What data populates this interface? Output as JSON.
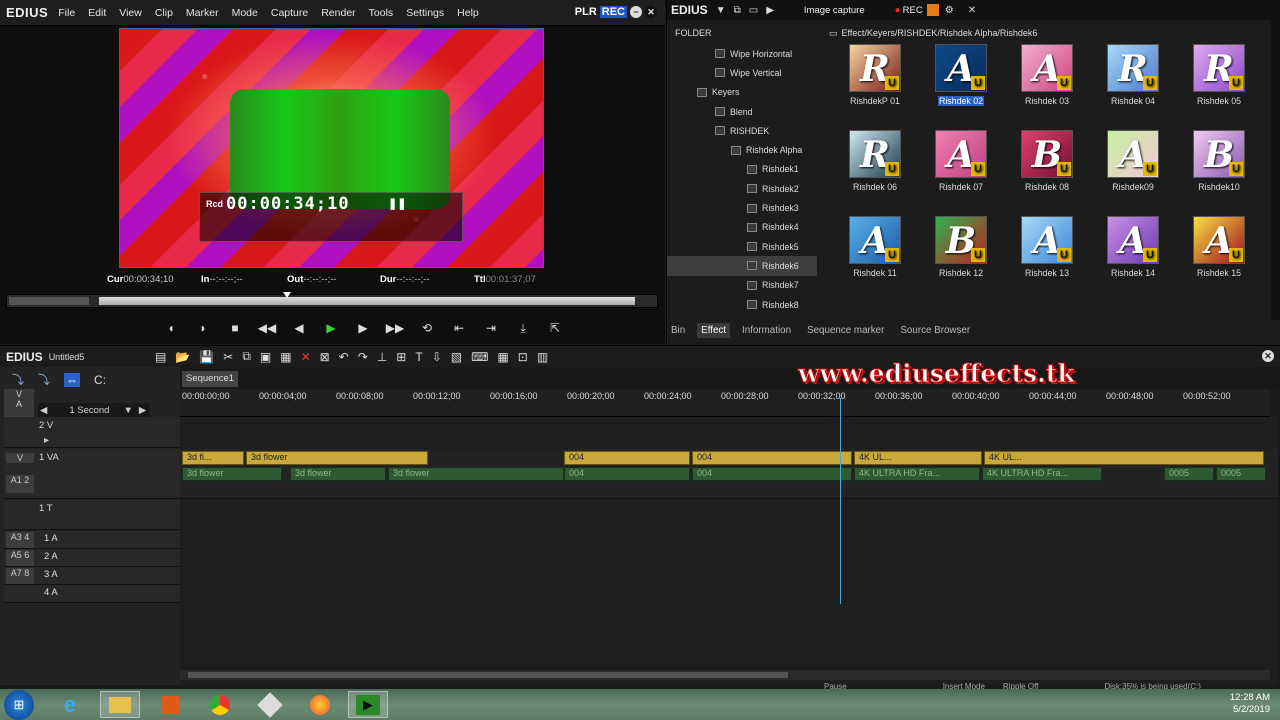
{
  "app": {
    "name": "EDIUS",
    "menu": [
      "File",
      "Edit",
      "View",
      "Clip",
      "Marker",
      "Mode",
      "Capture",
      "Render",
      "Tools",
      "Settings",
      "Help"
    ],
    "plr": "PLR",
    "rec": "REC"
  },
  "player": {
    "rcd": "Rcd",
    "timecode": "00:00:34;10",
    "cur_label": "Cur",
    "cur": "00:00:34;10",
    "in_label": "In",
    "in": "--:--:--;--",
    "out_label": "Out",
    "out": "--:--:--;--",
    "dur_label": "Dur",
    "dur": "--:--:--;--",
    "ttl_label": "Ttl",
    "ttl": "00:01:37;07",
    "playhead_fraction": 0.35
  },
  "right": {
    "logo": "EDIUS",
    "capture": "Image capture",
    "rec": "REC",
    "folder": "FOLDER",
    "path": "Effect/Keyers/RISHDEK/Rishdek Alpha/Rishdek6",
    "tree": [
      {
        "label": "Wipe Horizontal",
        "indent": 48
      },
      {
        "label": "Wipe Vertical",
        "indent": 48
      },
      {
        "label": "Keyers",
        "indent": 30
      },
      {
        "label": "Blend",
        "indent": 48
      },
      {
        "label": "RISHDEK",
        "indent": 48
      },
      {
        "label": "Rishdek Alpha",
        "indent": 64
      },
      {
        "label": "Rishdek1",
        "indent": 80
      },
      {
        "label": "Rishdek2",
        "indent": 80
      },
      {
        "label": "Rishdek3",
        "indent": 80
      },
      {
        "label": "Rishdek4",
        "indent": 80
      },
      {
        "label": "Rishdek5",
        "indent": 80
      },
      {
        "label": "Rishdek6",
        "indent": 80
      },
      {
        "label": "Rishdek7",
        "indent": 80
      },
      {
        "label": "Rishdek8",
        "indent": 80
      }
    ],
    "effects": [
      {
        "name": "RishdekP 01",
        "letter": "R",
        "c1": "#f5d7a0",
        "c2": "#7a1a1a"
      },
      {
        "name": "Rishdek 02",
        "letter": "A",
        "c1": "#0c4a8a",
        "c2": "#0a2a5a"
      },
      {
        "name": "Rishdek 03",
        "letter": "A",
        "c1": "#f0b0d0",
        "c2": "#d04080"
      },
      {
        "name": "Rishdek 04",
        "letter": "R",
        "c1": "#a8d8f8",
        "c2": "#4a7ac8"
      },
      {
        "name": "Rishdek 05",
        "letter": "R",
        "c1": "#e0a8f0",
        "c2": "#8a4ac8"
      },
      {
        "name": "Rishdek 06",
        "letter": "R",
        "c1": "#d0e8f0",
        "c2": "#1a3a4a"
      },
      {
        "name": "Rishdek 07",
        "letter": "A",
        "c1": "#f080b0",
        "c2": "#c04080"
      },
      {
        "name": "Rishdek 08",
        "letter": "B",
        "c1": "#e04070",
        "c2": "#701030"
      },
      {
        "name": "Rishdek09",
        "letter": "A",
        "c1": "#c8f0a0",
        "c2": "#f0c8d8"
      },
      {
        "name": "Rishdek10",
        "letter": "B",
        "c1": "#f0c8f0",
        "c2": "#8a5ab0"
      },
      {
        "name": "Rishdek 11",
        "letter": "A",
        "c1": "#5ab0e8",
        "c2": "#1a5aa8"
      },
      {
        "name": "Rishdek 12",
        "letter": "B",
        "c1": "#30b050",
        "c2": "#c02020"
      },
      {
        "name": "Rishdek 13",
        "letter": "A",
        "c1": "#a8d8f8",
        "c2": "#3a88d8"
      },
      {
        "name": "Rishdek 14",
        "letter": "A",
        "c1": "#c890e8",
        "c2": "#6a3ab0"
      },
      {
        "name": "Rishdek 15",
        "letter": "A",
        "c1": "#f8e040",
        "c2": "#a01020"
      }
    ],
    "tabs": [
      "Bin",
      "Effect",
      "Information",
      "Sequence marker",
      "Source Browser"
    ]
  },
  "timeline": {
    "logo": "EDIUS",
    "project": "Untitled5",
    "sequence": "Sequence1",
    "zoom": "1 Second",
    "watermark": "www.ediuseffects.tk",
    "ruler": [
      "00:00:00;00",
      "00:00:04;00",
      "00:00:08;00",
      "00:00:12;00",
      "00:00:16;00",
      "00:00:20;00",
      "00:00:24;00",
      "00:00:28;00",
      "00:00:32;00",
      "00:00:36;00",
      "00:00:40;00",
      "00:00:44;00",
      "00:00:48;00",
      "00:00:52;00"
    ],
    "tracks": {
      "t2v": "2 V",
      "t1va": "1 VA",
      "t1t": "1 T",
      "a1": "1 A",
      "a2": "2 A",
      "a3": "3 A",
      "a4": "4 A"
    },
    "tags": {
      "v": "V",
      "a": "A",
      "va": "V",
      "a12": "A1 2",
      "a34": "A3 4",
      "a56": "A5 6",
      "a78": "A7 8"
    },
    "clips": {
      "c1": "3d fl...",
      "c2": "3d flower",
      "c3": "004",
      "c4": "004",
      "c5": "4K UL...",
      "c6": "4K UL..."
    },
    "audio": {
      "a1": "3d flower",
      "a2": "3d flower",
      "a3": "3d flower",
      "a4": "004",
      "a5": "004",
      "a6": "4K ULTRA HD Fra...",
      "a7": "4K ULTRA HD Fra...",
      "a8": "0005",
      "a9": "0005"
    }
  },
  "status": {
    "pause": "Pause",
    "insert": "Insert Mode",
    "ripple": "Ripple Off",
    "disk": "Disk:35% is being used(C:)"
  },
  "clock": {
    "time": "12:28 AM",
    "date": "5/2/2019"
  }
}
